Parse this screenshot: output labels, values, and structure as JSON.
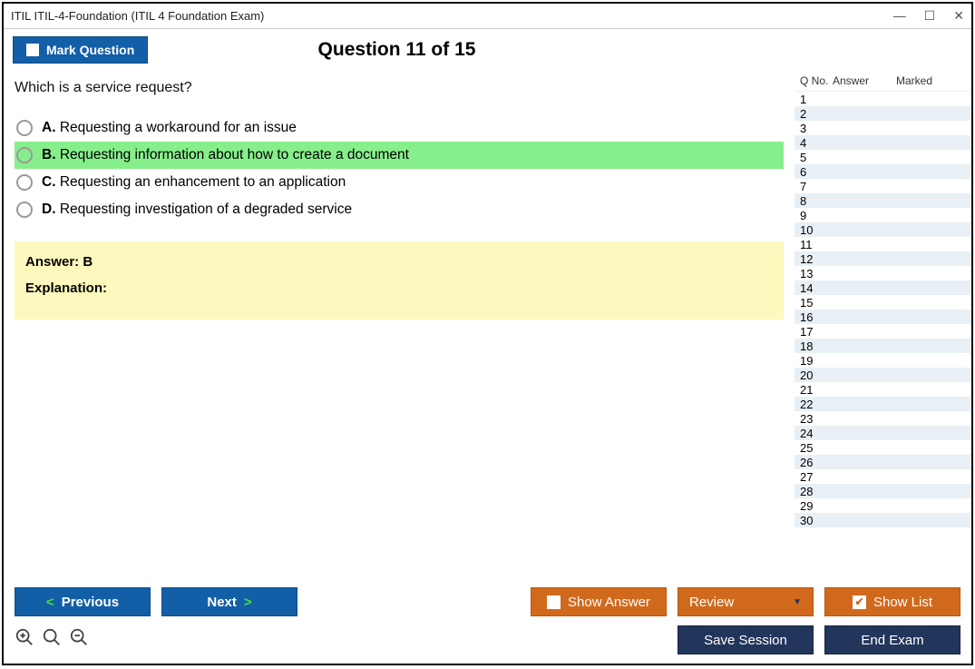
{
  "window_title": "ITIL ITIL-4-Foundation (ITIL 4 Foundation Exam)",
  "mark_label": "Mark Question",
  "question_header": "Question 11 of 15",
  "question_text": "Which is a service request?",
  "options": [
    {
      "letter": "A.",
      "text": "Requesting a workaround for an issue",
      "selected": false
    },
    {
      "letter": "B.",
      "text": "Requesting information about how to create a document",
      "selected": true
    },
    {
      "letter": "C.",
      "text": "Requesting an enhancement to an application",
      "selected": false
    },
    {
      "letter": "D.",
      "text": "Requesting investigation of a degraded service",
      "selected": false
    }
  ],
  "answer_label": "Answer: B",
  "explanation_label": "Explanation:",
  "side_headers": {
    "qno": "Q No.",
    "answer": "Answer",
    "marked": "Marked"
  },
  "side_rows": [
    1,
    2,
    3,
    4,
    5,
    6,
    7,
    8,
    9,
    10,
    11,
    12,
    13,
    14,
    15,
    16,
    17,
    18,
    19,
    20,
    21,
    22,
    23,
    24,
    25,
    26,
    27,
    28,
    29,
    30
  ],
  "buttons": {
    "previous": "Previous",
    "next": "Next",
    "show_answer": "Show Answer",
    "review": "Review",
    "show_list": "Show List",
    "save_session": "Save Session",
    "end_exam": "End Exam"
  }
}
